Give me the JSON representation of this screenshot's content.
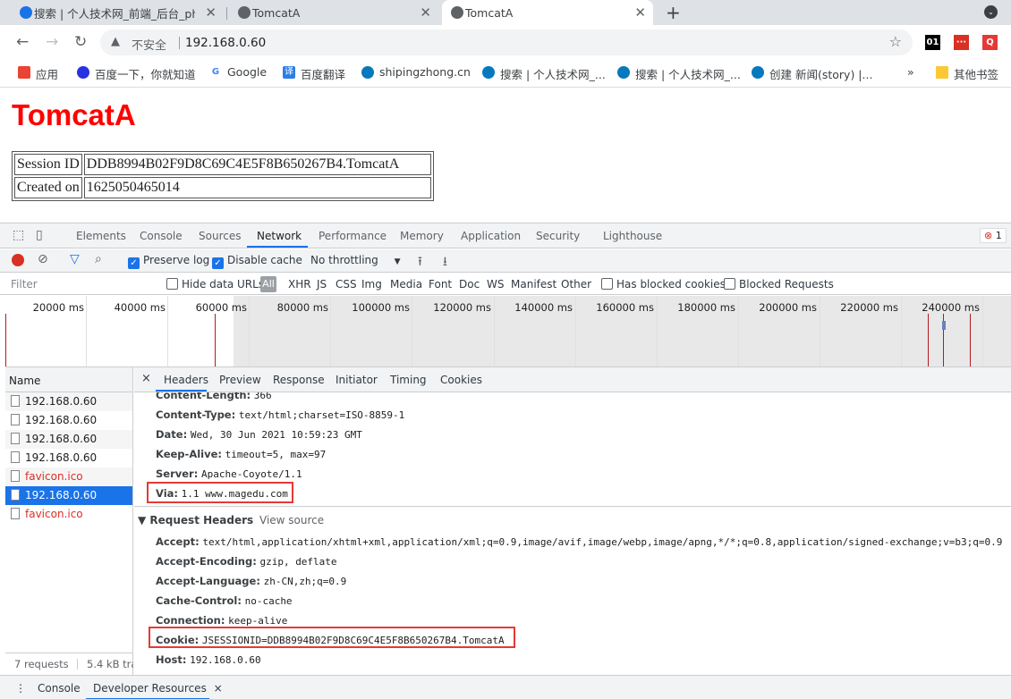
{
  "browser": {
    "tabs": [
      {
        "title": "搜索 | 个人技术网_前端_后台_php"
      },
      {
        "title": "TomcatA"
      },
      {
        "title": "TomcatA"
      }
    ],
    "new_tab": "+",
    "tab_menu": "⌄",
    "nav": {
      "back": "←",
      "forward": "→",
      "reload": "↻"
    },
    "address": {
      "warning_icon": "▲",
      "insecure_label": "不安全",
      "url": "192.168.0.60",
      "star": "☆"
    },
    "extensions": [
      "01",
      "···",
      "Q"
    ],
    "bookmarks": [
      {
        "label": "应用"
      },
      {
        "label": "百度一下，你就知道"
      },
      {
        "label": "Google"
      },
      {
        "label": "百度翻译"
      },
      {
        "label": "shipingzhong.cn"
      },
      {
        "label": "搜索 | 个人技术网_..."
      },
      {
        "label": "搜索 | 个人技术网_..."
      },
      {
        "label": "创建 新闻(story) |..."
      }
    ],
    "bookmarks_more": "»",
    "other_bookmarks": "其他书签"
  },
  "page": {
    "title": "TomcatA",
    "session_table": [
      {
        "label": "Session ID",
        "value": "DDB8994B02F9D8C69C4E5F8B650267B4.TomcatA"
      },
      {
        "label": "Created on",
        "value": "1625050465014"
      }
    ]
  },
  "devtools": {
    "tabs": [
      "Elements",
      "Console",
      "Sources",
      "Network",
      "Performance",
      "Memory",
      "Application",
      "Security",
      "Lighthouse"
    ],
    "active_tab": "Network",
    "error_count": "1",
    "error_icon": "⊗",
    "network_toolbar": {
      "preserve_log": "Preserve log",
      "disable_cache": "Disable cache",
      "throttling": "No throttling",
      "throttle_arrow": "▼"
    },
    "filter_bar": {
      "placeholder": "Filter",
      "hide_data_urls": "Hide data URLs",
      "all": "All",
      "types": [
        "XHR",
        "JS",
        "CSS",
        "Img",
        "Media",
        "Font",
        "Doc",
        "WS",
        "Manifest",
        "Other"
      ],
      "has_blocked_cookies": "Has blocked cookies",
      "blocked_requests": "Blocked Requests"
    },
    "timeline_labels": [
      "20000 ms",
      "40000 ms",
      "60000 ms",
      "80000 ms",
      "100000 ms",
      "120000 ms",
      "140000 ms",
      "160000 ms",
      "180000 ms",
      "200000 ms",
      "220000 ms",
      "240000 ms"
    ],
    "requests": {
      "header": "Name",
      "rows": [
        {
          "name": "192.168.0.60",
          "status": "normal"
        },
        {
          "name": "192.168.0.60",
          "status": "normal"
        },
        {
          "name": "192.168.0.60",
          "status": "normal"
        },
        {
          "name": "192.168.0.60",
          "status": "normal"
        },
        {
          "name": "favicon.ico",
          "status": "error"
        },
        {
          "name": "192.168.0.60",
          "status": "selected"
        },
        {
          "name": "favicon.ico",
          "status": "error"
        }
      ],
      "count": "7 requests",
      "transferred": "5.4 kB tran"
    },
    "detail_tabs": [
      "Headers",
      "Preview",
      "Response",
      "Initiator",
      "Timing",
      "Cookies"
    ],
    "detail_close": "×",
    "response_headers": [
      {
        "name": "Content-Length:",
        "value": "366"
      },
      {
        "name": "Content-Type:",
        "value": "text/html;charset=ISO-8859-1"
      },
      {
        "name": "Date:",
        "value": "Wed, 30 Jun 2021 10:59:23 GMT"
      },
      {
        "name": "Keep-Alive:",
        "value": "timeout=5, max=97"
      },
      {
        "name": "Server:",
        "value": "Apache-Coyote/1.1"
      },
      {
        "name": "Via:",
        "value": "1.1 www.magedu.com"
      }
    ],
    "request_headers_title": "▼ Request Headers",
    "view_source": "View source",
    "request_headers": [
      {
        "name": "Accept:",
        "value": "text/html,application/xhtml+xml,application/xml;q=0.9,image/avif,image/webp,image/apng,*/*;q=0.8,application/signed-exchange;v=b3;q=0.9"
      },
      {
        "name": "Accept-Encoding:",
        "value": "gzip, deflate"
      },
      {
        "name": "Accept-Language:",
        "value": "zh-CN,zh;q=0.9"
      },
      {
        "name": "Cache-Control:",
        "value": "no-cache"
      },
      {
        "name": "Connection:",
        "value": "keep-alive"
      },
      {
        "name": "Cookie:",
        "value": "JSESSIONID=DDB8994B02F9D8C69C4E5F8B650267B4.TomcatA"
      },
      {
        "name": "Host:",
        "value": "192.168.0.60"
      }
    ],
    "drawer": {
      "menu": "⋮",
      "console": "Console",
      "developer_resources": "Developer Resources",
      "close": "×"
    }
  }
}
